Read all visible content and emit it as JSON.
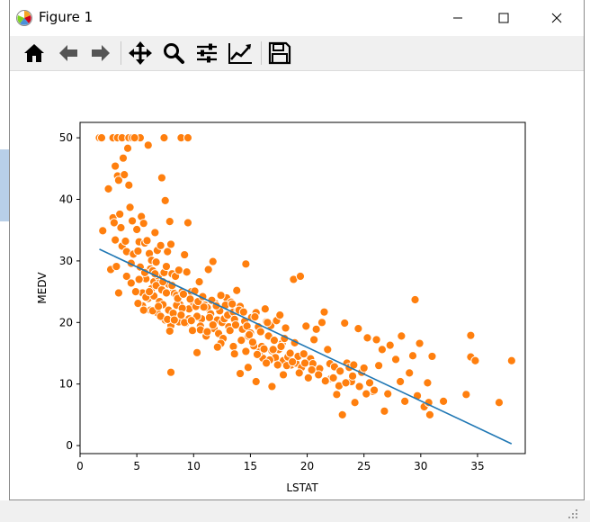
{
  "window": {
    "title": "Figure 1"
  },
  "toolbar": {
    "buttons": [
      {
        "name": "home",
        "icon": "home-icon"
      },
      {
        "name": "back",
        "icon": "arrow-left-icon"
      },
      {
        "name": "forward",
        "icon": "arrow-right-icon"
      },
      {
        "name": "pan",
        "icon": "move-icon"
      },
      {
        "name": "zoom",
        "icon": "magnifier-icon"
      },
      {
        "name": "configure-subplots",
        "icon": "sliders-icon"
      },
      {
        "name": "edit-axis",
        "icon": "line-chart-icon"
      },
      {
        "name": "save",
        "icon": "floppy-disk-icon"
      }
    ]
  },
  "colors": {
    "points": "#ff7f0e",
    "point_edge": "#ffffff",
    "line": "#1f77b4",
    "toolbar_bg": "#f0f0f0"
  },
  "chart_data": {
    "type": "scatter",
    "xlabel": "LSTAT",
    "ylabel": "MEDV",
    "xlim": [
      0,
      39.2
    ],
    "ylim": [
      -1.3,
      52.5
    ],
    "xticks": [
      0,
      5,
      10,
      15,
      20,
      25,
      30,
      35
    ],
    "yticks": [
      0,
      10,
      20,
      30,
      40,
      50
    ],
    "grid": false,
    "series": [
      {
        "kind": "scatter",
        "color": "#ff7f0e",
        "points": [
          [
            1.7,
            50
          ],
          [
            1.9,
            50
          ],
          [
            2.9,
            50
          ],
          [
            3.3,
            50
          ],
          [
            3.7,
            50
          ],
          [
            4.3,
            50
          ],
          [
            4.6,
            50
          ],
          [
            5.0,
            50
          ],
          [
            7.4,
            50
          ],
          [
            8.9,
            50
          ],
          [
            9.5,
            50
          ],
          [
            5.3,
            50
          ],
          [
            2.0,
            34.9
          ],
          [
            2.5,
            41.7
          ],
          [
            2.9,
            37.0
          ],
          [
            3.0,
            36.2
          ],
          [
            3.1,
            45.4
          ],
          [
            3.1,
            33.4
          ],
          [
            3.3,
            43.8
          ],
          [
            3.4,
            43.1
          ],
          [
            3.5,
            37.6
          ],
          [
            3.6,
            35.4
          ],
          [
            3.7,
            32.4
          ],
          [
            3.8,
            46.7
          ],
          [
            3.9,
            44.0
          ],
          [
            4.0,
            33.2
          ],
          [
            4.1,
            31.5
          ],
          [
            4.2,
            48.3
          ],
          [
            4.3,
            42.3
          ],
          [
            4.4,
            38.7
          ],
          [
            4.5,
            29.6
          ],
          [
            4.6,
            36.5
          ],
          [
            4.7,
            31.1
          ],
          [
            4.8,
            50.0
          ],
          [
            5.0,
            35.1
          ],
          [
            5.1,
            31.6
          ],
          [
            5.2,
            33.1
          ],
          [
            5.3,
            29.0
          ],
          [
            5.4,
            37.2
          ],
          [
            5.5,
            24.8
          ],
          [
            5.6,
            36.1
          ],
          [
            5.7,
            32.9
          ],
          [
            5.8,
            27.1
          ],
          [
            5.9,
            33.3
          ],
          [
            6.0,
            48.8
          ],
          [
            6.1,
            31.2
          ],
          [
            6.2,
            28.7
          ],
          [
            6.3,
            30.1
          ],
          [
            6.4,
            28.4
          ],
          [
            6.5,
            26.6
          ],
          [
            6.6,
            34.6
          ],
          [
            6.7,
            29.8
          ],
          [
            6.8,
            31.7
          ],
          [
            6.9,
            27.5
          ],
          [
            7.0,
            26.4
          ],
          [
            7.1,
            32.5
          ],
          [
            7.2,
            43.5
          ],
          [
            7.4,
            28.1
          ],
          [
            7.5,
            39.8
          ],
          [
            7.6,
            29.1
          ],
          [
            7.7,
            31.5
          ],
          [
            7.8,
            26.2
          ],
          [
            7.9,
            36.4
          ],
          [
            8.0,
            32.7
          ],
          [
            8.1,
            27.9
          ],
          [
            8.2,
            25.0
          ],
          [
            8.3,
            24.7
          ],
          [
            8.4,
            27.5
          ],
          [
            8.5,
            24.4
          ],
          [
            8.7,
            28.5
          ],
          [
            8.8,
            22.9
          ],
          [
            9.0,
            25.0
          ],
          [
            9.2,
            31.0
          ],
          [
            9.4,
            28.2
          ],
          [
            9.5,
            36.2
          ],
          [
            9.6,
            22.2
          ],
          [
            9.8,
            25.0
          ],
          [
            10.0,
            23.2
          ],
          [
            10.2,
            22.6
          ],
          [
            10.5,
            26.6
          ],
          [
            10.7,
            20.6
          ],
          [
            11.0,
            22.8
          ],
          [
            11.2,
            22.4
          ],
          [
            11.3,
            28.6
          ],
          [
            11.5,
            21.4
          ],
          [
            11.7,
            29.9
          ],
          [
            11.9,
            23.1
          ],
          [
            12.1,
            20.4
          ],
          [
            12.3,
            21.9
          ],
          [
            12.5,
            20.0
          ],
          [
            12.7,
            20.6
          ],
          [
            12.9,
            24.0
          ],
          [
            13.0,
            21.2
          ],
          [
            13.1,
            19.3
          ],
          [
            13.3,
            23.3
          ],
          [
            13.5,
            21.7
          ],
          [
            13.6,
            20.5
          ],
          [
            13.8,
            25.2
          ],
          [
            13.9,
            22.0
          ],
          [
            14.1,
            22.6
          ],
          [
            14.3,
            18.9
          ],
          [
            14.5,
            20.2
          ],
          [
            14.6,
            29.5
          ],
          [
            14.7,
            19.4
          ],
          [
            14.8,
            17.8
          ],
          [
            15.0,
            18.3
          ],
          [
            15.1,
            20.8
          ],
          [
            15.3,
            16.2
          ],
          [
            15.5,
            21.6
          ],
          [
            15.7,
            19.3
          ],
          [
            15.9,
            18.5
          ],
          [
            16.0,
            16.1
          ],
          [
            16.1,
            14.2
          ],
          [
            16.3,
            22.2
          ],
          [
            16.4,
            20.1
          ],
          [
            16.6,
            17.8
          ],
          [
            16.8,
            19.5
          ],
          [
            16.9,
            15.4
          ],
          [
            17.1,
            17.1
          ],
          [
            17.2,
            14.3
          ],
          [
            17.3,
            20.3
          ],
          [
            17.5,
            15.6
          ],
          [
            17.6,
            21.2
          ],
          [
            17.8,
            16.6
          ],
          [
            17.9,
            13.8
          ],
          [
            18.0,
            17.4
          ],
          [
            18.1,
            19.1
          ],
          [
            18.3,
            14.4
          ],
          [
            18.5,
            15.0
          ],
          [
            18.6,
            13.1
          ],
          [
            18.8,
            27.0
          ],
          [
            18.9,
            16.7
          ],
          [
            19.0,
            13.4
          ],
          [
            19.2,
            14.5
          ],
          [
            19.4,
            27.5
          ],
          [
            19.5,
            12.7
          ],
          [
            19.7,
            14.9
          ],
          [
            19.9,
            19.4
          ],
          [
            20.1,
            11.0
          ],
          [
            20.3,
            14.1
          ],
          [
            20.5,
            13.3
          ],
          [
            20.6,
            17.2
          ],
          [
            20.8,
            18.9
          ],
          [
            21.1,
            12.5
          ],
          [
            21.3,
            20.0
          ],
          [
            21.5,
            21.7
          ],
          [
            21.8,
            15.6
          ],
          [
            22.0,
            13.3
          ],
          [
            22.1,
            10.9
          ],
          [
            22.4,
            12.8
          ],
          [
            22.6,
            8.3
          ],
          [
            22.9,
            12.1
          ],
          [
            23.1,
            5.0
          ],
          [
            23.3,
            19.9
          ],
          [
            23.5,
            13.4
          ],
          [
            23.7,
            12.7
          ],
          [
            23.9,
            10.4
          ],
          [
            24.1,
            13.1
          ],
          [
            24.2,
            7.0
          ],
          [
            24.5,
            19.0
          ],
          [
            24.8,
            11.9
          ],
          [
            25.0,
            12.6
          ],
          [
            25.3,
            17.5
          ],
          [
            25.5,
            10.2
          ],
          [
            25.8,
            8.8
          ],
          [
            26.1,
            17.2
          ],
          [
            26.3,
            13.0
          ],
          [
            26.6,
            15.6
          ],
          [
            26.8,
            5.6
          ],
          [
            27.1,
            8.4
          ],
          [
            27.3,
            16.3
          ],
          [
            27.8,
            14.0
          ],
          [
            28.2,
            10.4
          ],
          [
            28.3,
            17.8
          ],
          [
            28.6,
            7.2
          ],
          [
            29.0,
            11.8
          ],
          [
            29.3,
            14.6
          ],
          [
            29.5,
            23.7
          ],
          [
            29.7,
            8.1
          ],
          [
            29.9,
            16.6
          ],
          [
            30.3,
            6.3
          ],
          [
            30.6,
            10.2
          ],
          [
            30.8,
            5.0
          ],
          [
            30.7,
            7.0
          ],
          [
            31.0,
            14.5
          ],
          [
            32.0,
            7.2
          ],
          [
            34.0,
            8.3
          ],
          [
            34.4,
            17.9
          ],
          [
            34.4,
            14.4
          ],
          [
            34.8,
            13.8
          ],
          [
            36.9,
            7.0
          ],
          [
            38.0,
            13.8
          ],
          [
            5.5,
            22.7
          ],
          [
            6.0,
            23.9
          ],
          [
            6.2,
            22.0
          ],
          [
            6.5,
            24.3
          ],
          [
            6.8,
            21.6
          ],
          [
            7.0,
            23.4
          ],
          [
            7.3,
            22.9
          ],
          [
            7.5,
            20.4
          ],
          [
            7.8,
            22.0
          ],
          [
            8.0,
            19.5
          ],
          [
            8.2,
            21.5
          ],
          [
            8.5,
            22.8
          ],
          [
            8.7,
            20.1
          ],
          [
            9.0,
            22.3
          ],
          [
            9.3,
            19.9
          ],
          [
            9.6,
            20.6
          ],
          [
            9.9,
            18.7
          ],
          [
            10.3,
            21.0
          ],
          [
            10.6,
            19.4
          ],
          [
            10.9,
            22.5
          ],
          [
            11.1,
            17.8
          ],
          [
            11.4,
            20.8
          ],
          [
            11.8,
            19.0
          ],
          [
            12.2,
            18.2
          ],
          [
            12.6,
            17.4
          ],
          [
            13.2,
            18.7
          ],
          [
            13.7,
            19.6
          ],
          [
            14.2,
            17.1
          ],
          [
            14.9,
            18.0
          ],
          [
            15.2,
            16.8
          ],
          [
            15.8,
            15.2
          ],
          [
            16.2,
            15.7
          ],
          [
            16.7,
            13.9
          ],
          [
            17.0,
            15.6
          ],
          [
            17.4,
            13.1
          ],
          [
            17.7,
            16.1
          ],
          [
            18.2,
            13.0
          ],
          [
            18.7,
            13.6
          ],
          [
            19.3,
            11.8
          ],
          [
            19.8,
            13.4
          ],
          [
            20.4,
            12.3
          ],
          [
            21.0,
            11.5
          ],
          [
            21.6,
            10.5
          ],
          [
            22.3,
            11.0
          ],
          [
            22.8,
            9.7
          ],
          [
            23.4,
            10.2
          ],
          [
            24.0,
            11.3
          ],
          [
            24.6,
            9.6
          ],
          [
            25.2,
            8.4
          ],
          [
            25.9,
            9.0
          ],
          [
            6.3,
            25.5
          ],
          [
            6.7,
            26.0
          ],
          [
            7.2,
            25.3
          ],
          [
            7.6,
            24.8
          ],
          [
            8.1,
            26.0
          ],
          [
            8.6,
            23.9
          ],
          [
            9.1,
            24.6
          ],
          [
            9.7,
            23.8
          ],
          [
            10.1,
            25.1
          ],
          [
            10.4,
            23.4
          ],
          [
            10.8,
            24.2
          ],
          [
            11.6,
            23.6
          ],
          [
            12.0,
            22.7
          ],
          [
            12.4,
            24.4
          ],
          [
            12.8,
            22.8
          ],
          [
            13.4,
            23.0
          ],
          [
            14.0,
            22.0
          ],
          [
            14.4,
            21.7
          ],
          [
            15.4,
            20.9
          ],
          [
            16.5,
            20.0
          ],
          [
            4.9,
            25.0
          ],
          [
            5.1,
            23.1
          ],
          [
            5.6,
            22.0
          ],
          [
            5.8,
            24.1
          ],
          [
            6.4,
            21.9
          ],
          [
            6.9,
            22.6
          ],
          [
            7.1,
            21.0
          ],
          [
            7.7,
            20.5
          ],
          [
            8.3,
            20.4
          ],
          [
            8.9,
            21.2
          ],
          [
            9.2,
            20.0
          ],
          [
            9.8,
            20.3
          ],
          [
            10.6,
            18.8
          ],
          [
            11.2,
            18.5
          ],
          [
            11.7,
            19.6
          ],
          [
            12.4,
            16.6
          ],
          [
            13.5,
            16.1
          ],
          [
            14.6,
            15.3
          ],
          [
            15.6,
            14.8
          ],
          [
            16.4,
            13.4
          ],
          [
            2.7,
            28.6
          ],
          [
            3.2,
            29.1
          ],
          [
            3.4,
            24.8
          ],
          [
            4.1,
            27.5
          ],
          [
            4.5,
            26.4
          ],
          [
            5.2,
            27.0
          ],
          [
            5.7,
            28.1
          ],
          [
            6.1,
            25.0
          ],
          [
            6.6,
            27.9
          ],
          [
            7.3,
            26.6
          ],
          [
            7.9,
            18.6
          ],
          [
            8.0,
            11.9
          ],
          [
            10.3,
            15.1
          ],
          [
            12.1,
            16.0
          ],
          [
            13.6,
            14.9
          ],
          [
            14.1,
            11.7
          ],
          [
            14.8,
            12.7
          ],
          [
            15.5,
            10.4
          ],
          [
            16.9,
            9.6
          ],
          [
            17.9,
            11.5
          ]
        ]
      },
      {
        "kind": "line",
        "color": "#1f77b4",
        "points": [
          [
            1.7,
            31.9
          ],
          [
            38.0,
            0.3
          ]
        ]
      }
    ]
  }
}
